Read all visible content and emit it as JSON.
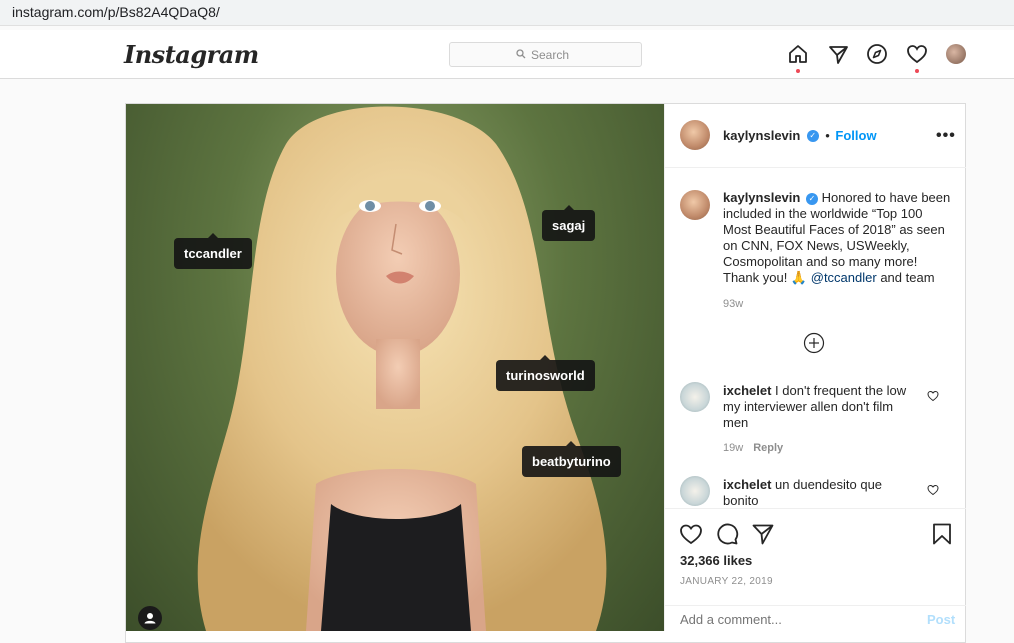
{
  "browser": {
    "url": "instagram.com/p/Bs82A4QDaQ8/"
  },
  "nav": {
    "logo": "Instagram",
    "search_placeholder": "Search",
    "icons": [
      "home-icon",
      "direct-icon",
      "explore-icon",
      "activity-heart-icon",
      "profile-avatar"
    ]
  },
  "post": {
    "photo_tags": [
      "tccandler",
      "sagaj",
      "turinosworld",
      "beatbyturino"
    ],
    "author": {
      "username": "kaylynslevin",
      "verified": true,
      "follow_label": "Follow"
    },
    "caption": {
      "username": "kaylynslevin",
      "text_lines": [
        "Honored to have been",
        "included in the worldwide “Top 100",
        "Most Beautiful Faces of 2018” as seen",
        "on CNN, FOX News, USWeekly,",
        "Cosmopolitan and so many more!",
        "Thank you! 🙏"
      ],
      "mention": "@tccandler",
      "tail": " and team",
      "age": "93w"
    },
    "comments": [
      {
        "username": "ixchelet",
        "line1": "I don't frequent the low",
        "line2": "my interviewer allen don't film",
        "line3": "men",
        "age": "19w",
        "reply_label": "Reply"
      },
      {
        "username": "ixchelet",
        "line1": "un duendesito que",
        "line2": "bonito"
      }
    ],
    "likes": "32,366 likes",
    "date": "JANUARY 22, 2019",
    "add_comment_placeholder": "Add a comment...",
    "post_label": "Post"
  },
  "colors": {
    "accent": "#0095f6",
    "notification": "#ed4956",
    "border": "#dbdbdb"
  }
}
